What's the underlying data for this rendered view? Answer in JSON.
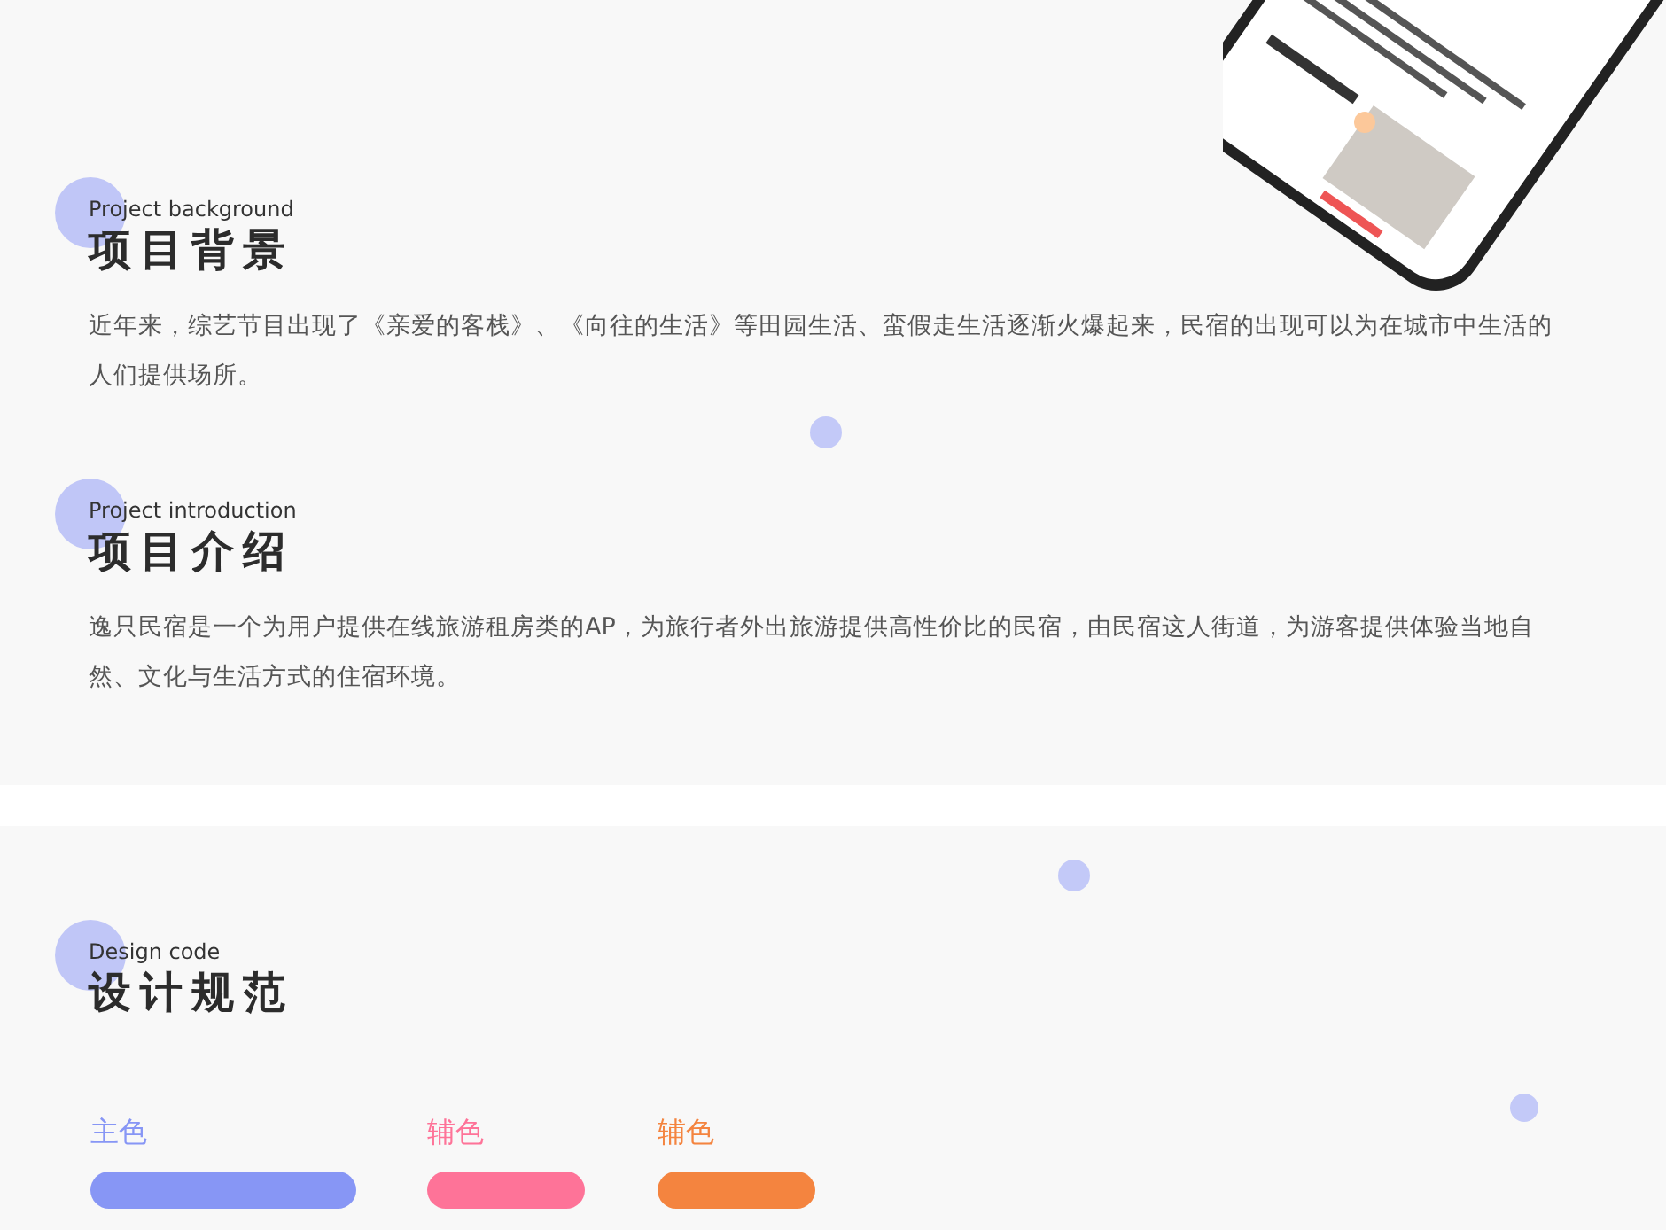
{
  "sections": [
    {
      "label": "Project background",
      "title": "项目背景",
      "text": "近年来，综艺节目出现了《亲爱的客栈》、《向往的生活》等田园生活、蛮假走生活逐渐火爆起来，民宿的出现可以为在城市中生活的人们提供场所。"
    },
    {
      "label": "Project introduction",
      "title": "项目介绍",
      "text": "逸只民宿是一个为用户提供在线旅游租房类的AP，为旅行者外出旅游提供高性价比的民宿，由民宿这人街道，为游客提供体验当地自然、文化与生活方式的住宿环境。"
    }
  ],
  "design": {
    "label": "Design code",
    "title": "设计规范",
    "swatches": [
      {
        "name": "主色",
        "kind": "primary",
        "color": "#8796f5"
      },
      {
        "name": "辅色",
        "kind": "secondary",
        "color": "#fe7398"
      },
      {
        "name": "辅色",
        "kind": "secondary",
        "color": "#f4843f"
      }
    ]
  }
}
